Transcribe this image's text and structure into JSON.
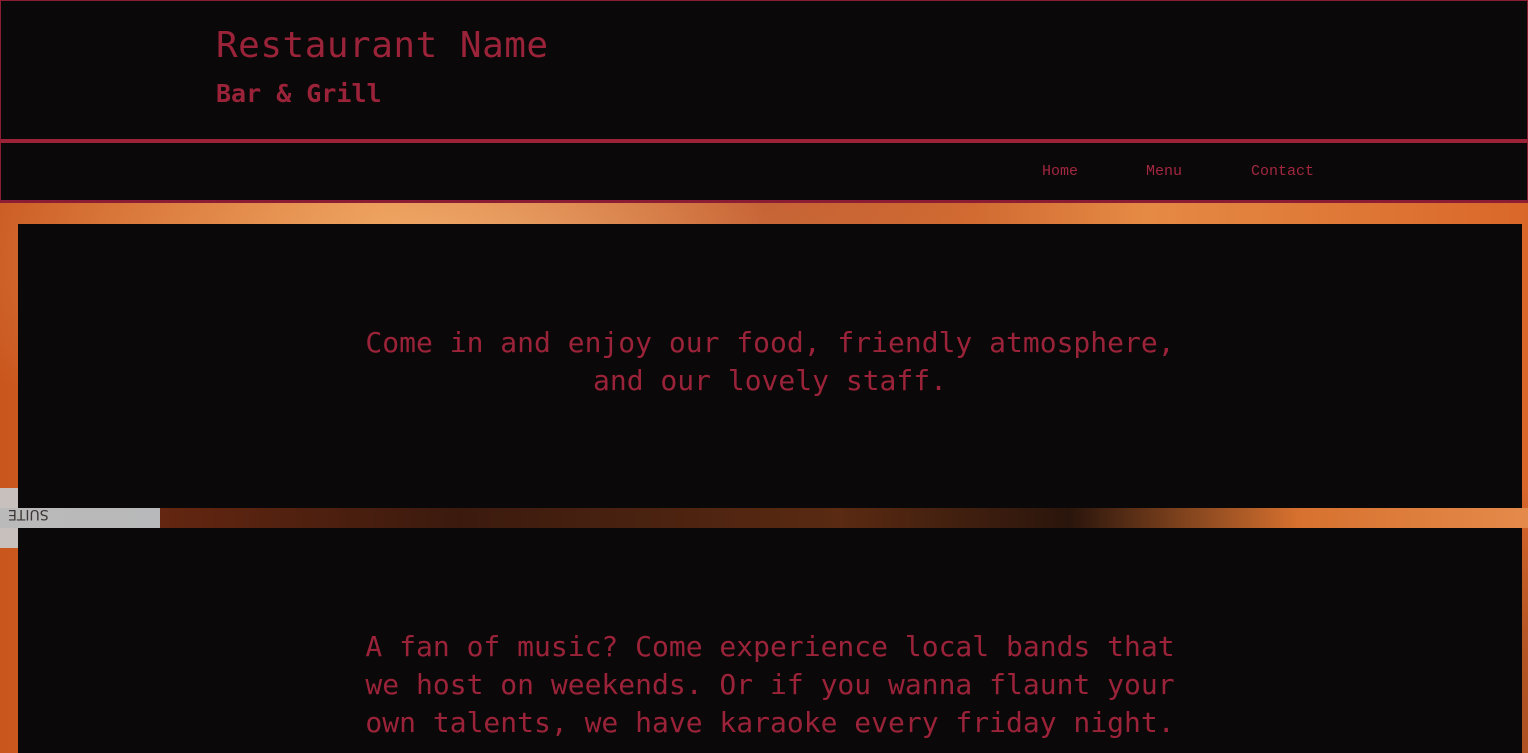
{
  "header": {
    "title": "Restaurant Name",
    "subtitle": "Bar & Grill"
  },
  "nav": {
    "items": [
      {
        "label": "Home"
      },
      {
        "label": "Menu"
      },
      {
        "label": "Contact"
      }
    ]
  },
  "background": {
    "sign_text": "SUITE"
  },
  "sections": [
    {
      "text": "Come in and enjoy our food, friendly atmosphere, and our lovely staff."
    },
    {
      "text": "A fan of music? Come experience local bands that we host on weekends. Or if you wanna flaunt your own talents, we have karaoke every friday night."
    }
  ],
  "colors": {
    "accent": "#9b2339",
    "background": "#0a0808"
  }
}
